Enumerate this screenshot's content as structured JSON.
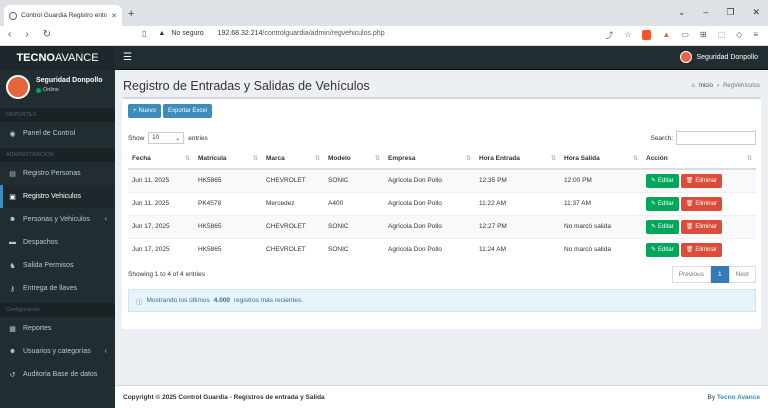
{
  "browser": {
    "tab_title": "Control Guardia Registro entrad",
    "new_tab": "+",
    "security_label": "No seguro",
    "url_host": "192.68.32.214",
    "url_path": "/controlguardia/admin/regvehiculos.php"
  },
  "header": {
    "logo_bold": "TECNO",
    "logo_rest": "AVANCE",
    "user_name": "Seguridad Donpollo"
  },
  "sidebar": {
    "user_name": "Seguridad Donpollo",
    "status": "Online",
    "sections": [
      "REPORTES",
      "ADMINISTRACION",
      "Configuración"
    ],
    "items": [
      {
        "label": "Panel de Control",
        "icon": "dashboard-icon"
      },
      {
        "label": "Registro Personas",
        "icon": "id-card-icon"
      },
      {
        "label": "Registro Vehiculos",
        "icon": "car-icon"
      },
      {
        "label": "Personas y Vehiculos",
        "icon": "users-icon"
      },
      {
        "label": "Despachos",
        "icon": "truck-icon"
      },
      {
        "label": "Salida Permisos",
        "icon": "walk-icon"
      },
      {
        "label": "Entrega de llaves",
        "icon": "key-icon"
      },
      {
        "label": "Reportes",
        "icon": "report-icon"
      },
      {
        "label": "Usuarios y categorías",
        "icon": "users-icon"
      },
      {
        "label": "Auditoria Base de datos",
        "icon": "history-icon"
      }
    ]
  },
  "page": {
    "title": "Registro de Entradas y Salidas de Vehículos",
    "breadcrumb_home": "Inicio",
    "breadcrumb_current": "RegVehículos"
  },
  "toolbar": {
    "new_label": "Nuevo",
    "new_plus": "+",
    "export_label": "Exportar Excel"
  },
  "table_controls": {
    "show": "Show",
    "length_value": "10",
    "entries": "entries",
    "search_label": "Search:"
  },
  "table": {
    "columns": [
      "Fecha",
      "Matrícula",
      "Marca",
      "Modelo",
      "Empresa",
      "Hora Entrada",
      "Hora Salida",
      "Acción"
    ],
    "rows": [
      [
        "Jun 11, 2025",
        "HK5865",
        "CHEVROLET",
        "SONIC",
        "Agrícola Don Pollo",
        "12:35 PM",
        "12:00 PM"
      ],
      [
        "Jun 11, 2025",
        "PK4578",
        "Mercedez",
        "A400",
        "Agrícola Don Pollo",
        "11:22 AM",
        "11:37 AM"
      ],
      [
        "Jun 17, 2025",
        "HK5865",
        "CHEVROLET",
        "SONIC",
        "Agrícola Don Pollo",
        "12:27 PM",
        "No marcó salida"
      ],
      [
        "Jun 17, 2025",
        "HK5865",
        "CHEVROLET",
        "SONIC",
        "Agrícola Don Pollo",
        "11:24 AM",
        "No marcó salida"
      ]
    ],
    "edit_label": "Editar",
    "delete_label": "Eliminar",
    "info": "Showing 1 to 4 of 4 entries",
    "previous": "Previous",
    "current_page": "1",
    "next": "Next"
  },
  "alert": {
    "prefix": "Mostrando los últimos",
    "count": "4.000",
    "suffix": "registros más recientes."
  },
  "footer": {
    "copyright": "Copyright © 2025 Control Guardia",
    "subtitle": " - Registros de entrada y Salida",
    "by": "By",
    "brand": "Tecno Avance"
  },
  "colors": {
    "primary": "#3c8dbc",
    "success": "#00a65a",
    "danger": "#dd4b39",
    "sidebar": "#222d32"
  }
}
